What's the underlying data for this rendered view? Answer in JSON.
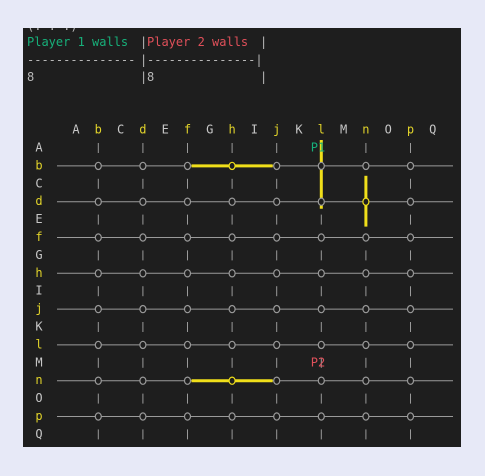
{
  "header": {
    "top_cut": "(. . .)",
    "p1_label": "Player 1 walls",
    "sep": "|",
    "p2_label": "Player 2 walls",
    "end_sep": "|",
    "rule_left": "---------------",
    "rule_mid": "|",
    "rule_right": "---------------|",
    "p1_count": "8",
    "p2_count_sep": "|",
    "p2_count": "8",
    "p2_count_end": "|"
  },
  "board": {
    "columns": [
      "A",
      "b",
      "C",
      "d",
      "E",
      "f",
      "G",
      "h",
      "I",
      "j",
      "K",
      "l",
      "M",
      "n",
      "O",
      "p",
      "Q"
    ],
    "rows": [
      "A",
      "b",
      "C",
      "d",
      "E",
      "f",
      "G",
      "h",
      "I",
      "j",
      "K",
      "l",
      "M",
      "n",
      "O",
      "p",
      "Q"
    ],
    "highlight_letters": [
      "b",
      "d",
      "f",
      "h",
      "j",
      "l",
      "n",
      "p"
    ],
    "pawns": [
      {
        "label": "P1",
        "row": "A",
        "col": "K",
        "player": 1
      },
      {
        "label": "P2",
        "row": "M",
        "col": "K",
        "player": 2
      }
    ],
    "walls": [
      {
        "orientation": "horizontal",
        "row": "b",
        "from": "f",
        "to": "j"
      },
      {
        "orientation": "vertical",
        "col": "l",
        "from": "A",
        "to": "d"
      },
      {
        "orientation": "vertical",
        "col": "n",
        "from": "C",
        "to": "E"
      },
      {
        "orientation": "horizontal",
        "row": "n",
        "from": "f",
        "to": "j"
      }
    ],
    "node_glyph": "o",
    "vertical_glyph": "|",
    "colors": {
      "text": "#c8c8c8",
      "highlight": "#e0d22a",
      "wall": "#f0df1a",
      "grid": "#9a9a9a",
      "p1": "#17b07a",
      "p2": "#e0505a",
      "background": "#1e1e1e"
    }
  }
}
